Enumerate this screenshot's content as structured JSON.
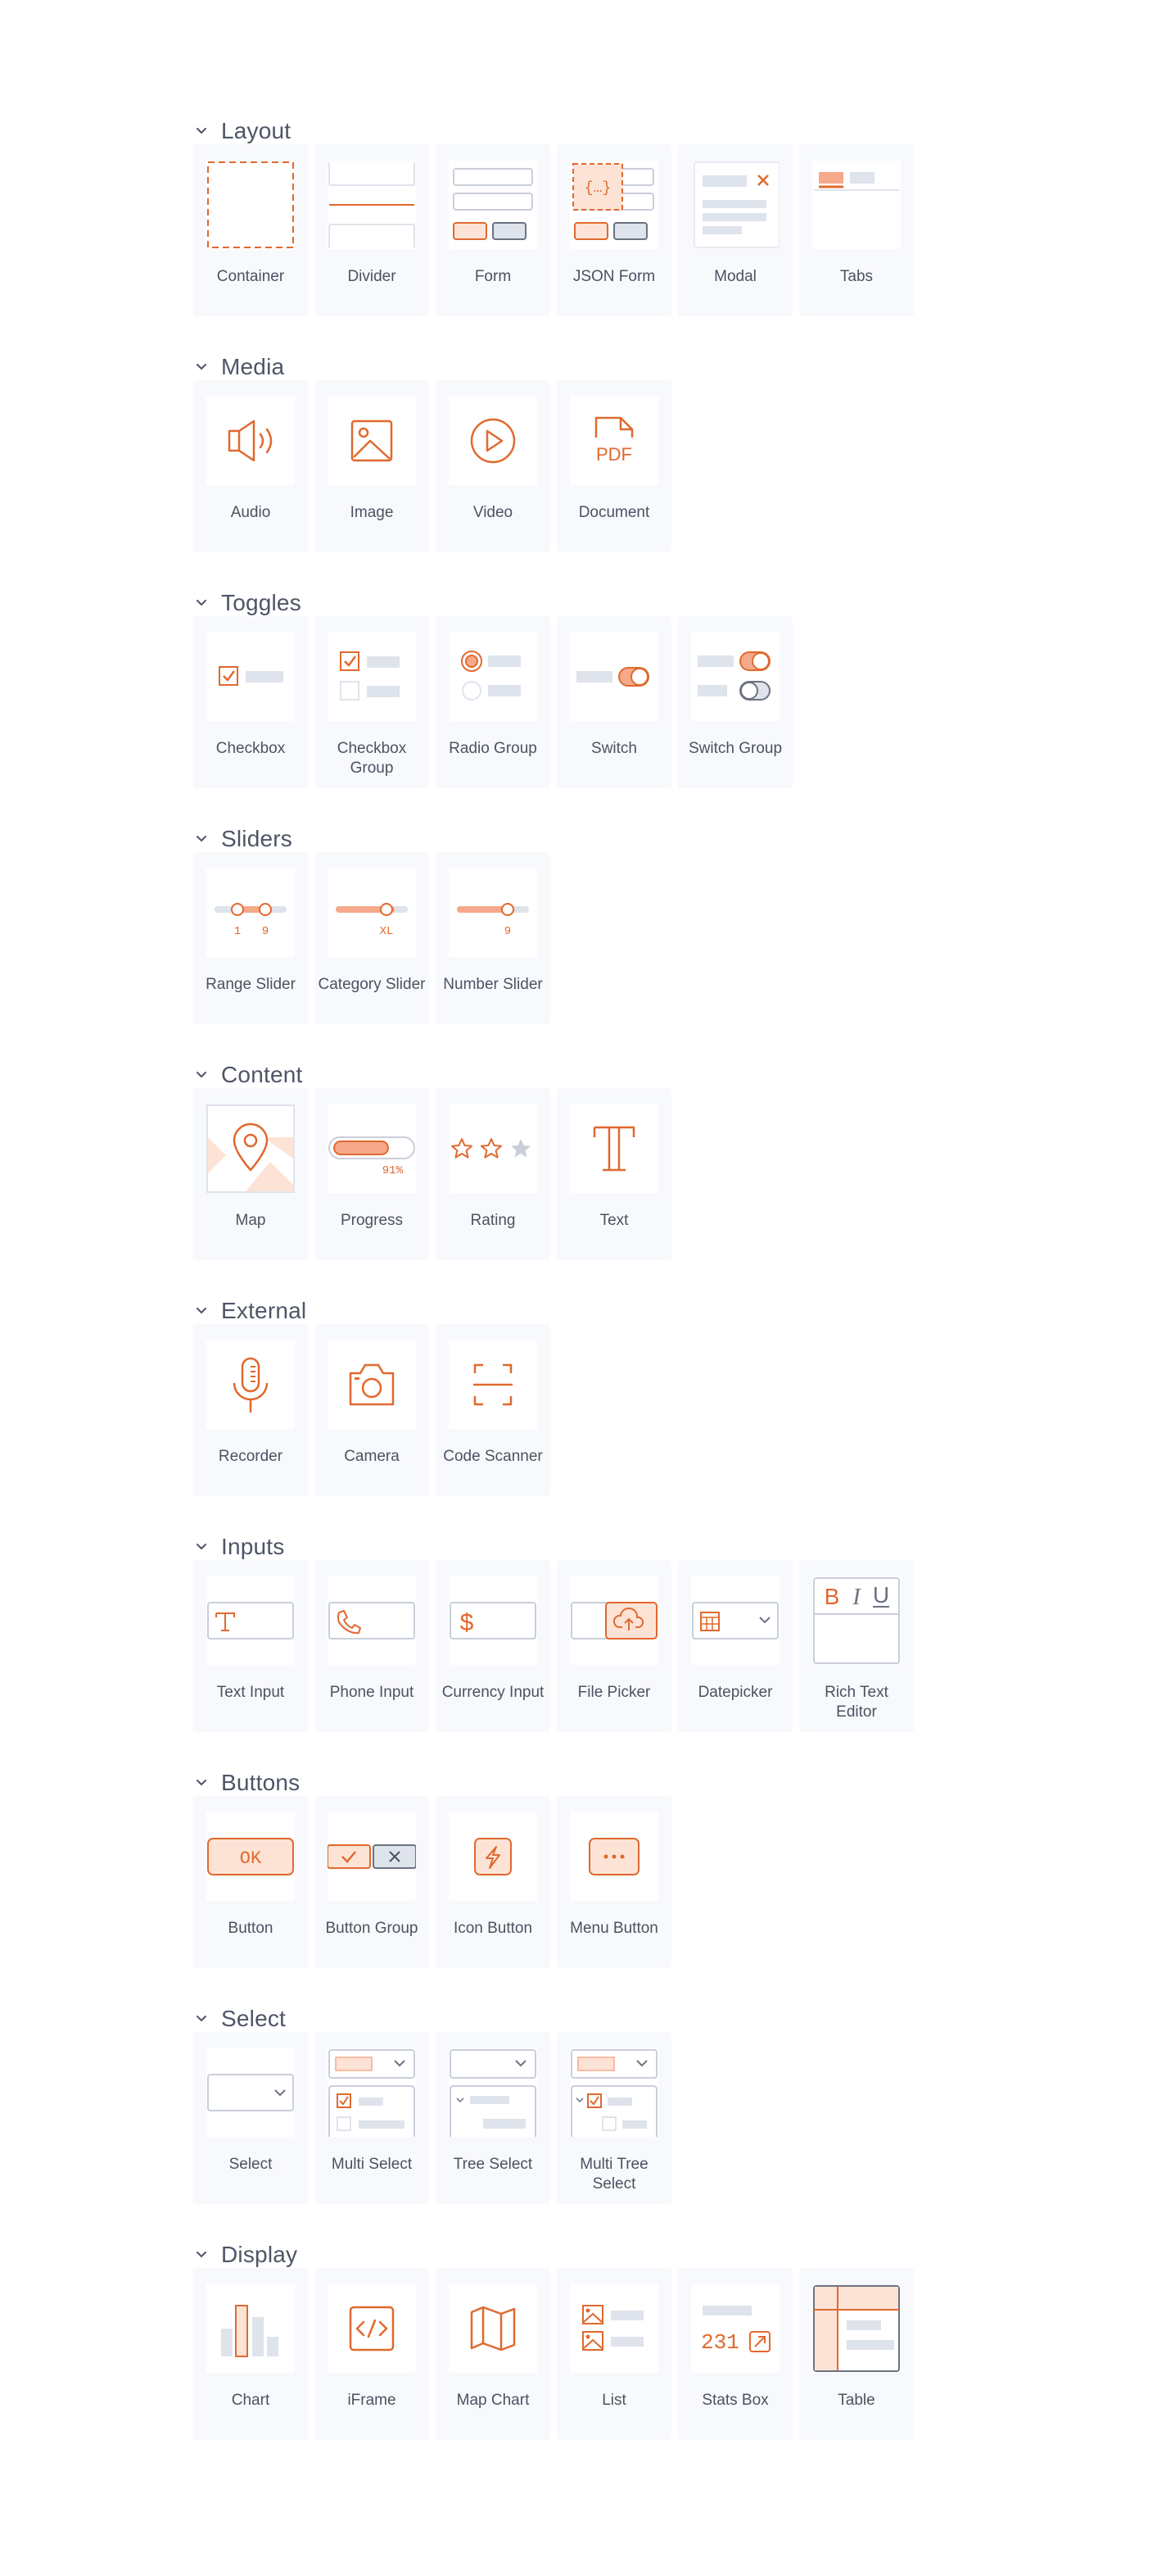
{
  "colors": {
    "accent": "#e0692e",
    "accent_fill": "#fde3d6",
    "accent_mid": "#f5a98a",
    "gray_fill": "#dfe3eb",
    "tile_bg": "#f8f9fc",
    "text": "#4b5261"
  },
  "sections": [
    {
      "title": "Layout",
      "items": [
        {
          "label": "Container",
          "icon": "container-icon"
        },
        {
          "label": "Divider",
          "icon": "divider-icon"
        },
        {
          "label": "Form",
          "icon": "form-icon"
        },
        {
          "label": "JSON Form",
          "icon": "json-form-icon"
        },
        {
          "label": "Modal",
          "icon": "modal-icon"
        },
        {
          "label": "Tabs",
          "icon": "tabs-icon"
        }
      ]
    },
    {
      "title": "Media",
      "items": [
        {
          "label": "Audio",
          "icon": "audio-icon"
        },
        {
          "label": "Image",
          "icon": "image-icon"
        },
        {
          "label": "Video",
          "icon": "video-icon"
        },
        {
          "label": "Document",
          "icon": "document-icon",
          "badge": "PDF"
        }
      ]
    },
    {
      "title": "Toggles",
      "items": [
        {
          "label": "Checkbox",
          "icon": "checkbox-icon"
        },
        {
          "label": "Checkbox Group",
          "icon": "checkbox-group-icon"
        },
        {
          "label": "Radio Group",
          "icon": "radio-group-icon"
        },
        {
          "label": "Switch",
          "icon": "switch-icon"
        },
        {
          "label": "Switch Group",
          "icon": "switch-group-icon"
        }
      ]
    },
    {
      "title": "Sliders",
      "items": [
        {
          "label": "Range Slider",
          "icon": "range-slider-icon",
          "values": [
            "1",
            "9"
          ]
        },
        {
          "label": "Category Slider",
          "icon": "category-slider-icon",
          "values": [
            "XL"
          ]
        },
        {
          "label": "Number Slider",
          "icon": "number-slider-icon",
          "values": [
            "9"
          ]
        }
      ]
    },
    {
      "title": "Content",
      "items": [
        {
          "label": "Map",
          "icon": "map-pin-icon"
        },
        {
          "label": "Progress",
          "icon": "progress-icon",
          "progress": 0.91,
          "progress_text": "91%"
        },
        {
          "label": "Rating",
          "icon": "rating-icon",
          "rating": 2,
          "rating_max": 3
        },
        {
          "label": "Text",
          "icon": "text-icon"
        }
      ]
    },
    {
      "title": "External",
      "items": [
        {
          "label": "Recorder",
          "icon": "microphone-icon"
        },
        {
          "label": "Camera",
          "icon": "camera-icon"
        },
        {
          "label": "Code Scanner",
          "icon": "scanner-icon"
        }
      ]
    },
    {
      "title": "Inputs",
      "items": [
        {
          "label": "Text Input",
          "icon": "text-input-icon"
        },
        {
          "label": "Phone Input",
          "icon": "phone-input-icon"
        },
        {
          "label": "Currency Input",
          "icon": "currency-input-icon"
        },
        {
          "label": "File Picker",
          "icon": "file-picker-icon"
        },
        {
          "label": "Datepicker",
          "icon": "datepicker-icon"
        },
        {
          "label": "Rich Text Editor",
          "icon": "rich-text-editor-icon",
          "glyphs": [
            "B",
            "I",
            "U"
          ]
        }
      ]
    },
    {
      "title": "Buttons",
      "items": [
        {
          "label": "Button",
          "icon": "button-icon",
          "text": "OK"
        },
        {
          "label": "Button Group",
          "icon": "button-group-icon"
        },
        {
          "label": "Icon Button",
          "icon": "icon-button-icon"
        },
        {
          "label": "Menu Button",
          "icon": "menu-button-icon"
        }
      ]
    },
    {
      "title": "Select",
      "items": [
        {
          "label": "Select",
          "icon": "select-icon"
        },
        {
          "label": "Multi Select",
          "icon": "multi-select-icon"
        },
        {
          "label": "Tree Select",
          "icon": "tree-select-icon"
        },
        {
          "label": "Multi Tree Select",
          "icon": "multi-tree-select-icon"
        }
      ]
    },
    {
      "title": "Display",
      "items": [
        {
          "label": "Chart",
          "icon": "chart-icon"
        },
        {
          "label": "iFrame",
          "icon": "iframe-icon"
        },
        {
          "label": "Map Chart",
          "icon": "map-chart-icon"
        },
        {
          "label": "List",
          "icon": "list-icon"
        },
        {
          "label": "Stats Box",
          "icon": "stats-box-icon",
          "text": "231"
        },
        {
          "label": "Table",
          "icon": "table-icon"
        }
      ]
    }
  ]
}
